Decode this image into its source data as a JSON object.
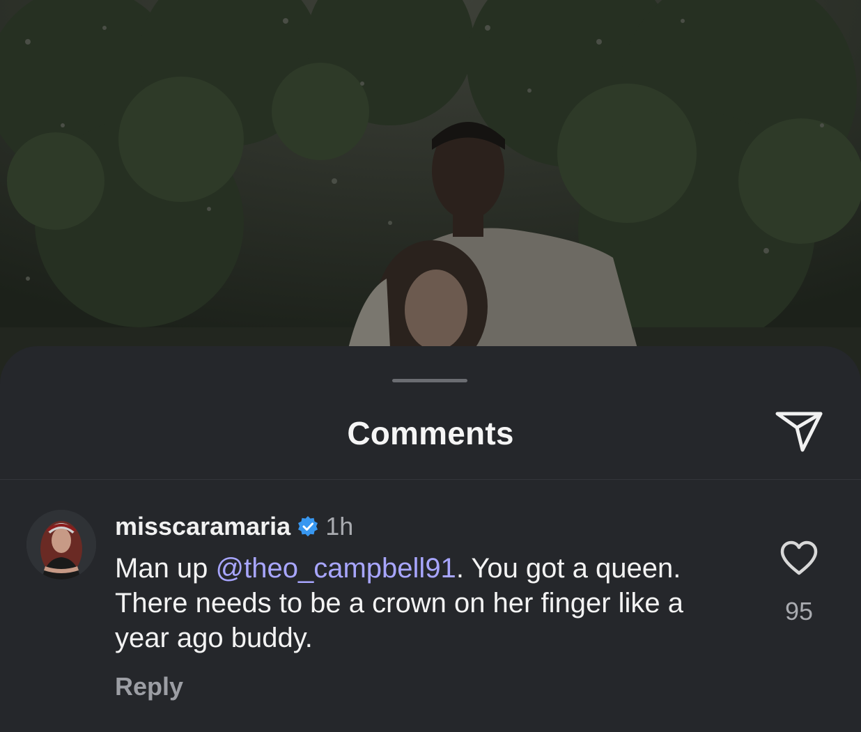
{
  "background": {
    "description_icon": "photo-background"
  },
  "sheet": {
    "title": "Comments",
    "share_icon": "send-icon"
  },
  "comment": {
    "username": "misscaramaria",
    "verified_icon": "verified-badge-icon",
    "timestamp": "1h",
    "text_before": "Man up ",
    "mention": "@theo_campbell91",
    "text_after": ". You got a queen. There needs to be a crown on her finger like a year ago buddy.",
    "reply_label": "Reply",
    "like_icon": "heart-icon",
    "like_count": "95"
  },
  "colors": {
    "sheet_bg": "#25272b",
    "mention": "#a8a6ff",
    "verified": "#3897f0"
  }
}
